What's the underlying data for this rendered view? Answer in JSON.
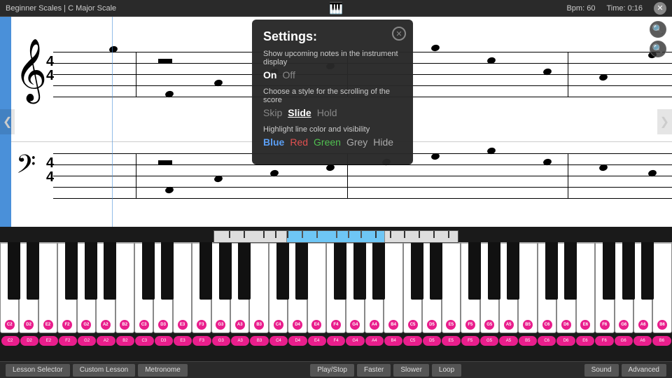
{
  "topBar": {
    "breadcrumb": "Beginner Scales  |  C Major Scale",
    "bpm_label": "Bpm: 60",
    "time_label": "Time: 0:16",
    "close_label": "✕"
  },
  "settings": {
    "title": "Settings:",
    "show_notes_label": "Show upcoming notes in the instrument display",
    "on_label": "On",
    "off_label": "Off",
    "scroll_label": "Choose a style for the scrolling of the score",
    "skip_label": "Skip",
    "slide_label": "Slide",
    "hold_label": "Hold",
    "highlight_label": "Highlight line color and visibility",
    "blue_label": "Blue",
    "red_label": "Red",
    "green_label": "Green",
    "grey_label": "Grey",
    "hide_label": "Hide",
    "close_label": "✕"
  },
  "navigation": {
    "left_arrow": "❮",
    "right_arrow": "❯"
  },
  "bottomBar": {
    "lesson_selector": "Lesson Selector",
    "custom_lesson": "Custom Lesson",
    "metronome": "Metronome",
    "play_stop": "Play/Stop",
    "faster": "Faster",
    "slower": "Slower",
    "loop": "Loop",
    "sound": "Sound",
    "advanced": "Advanced"
  },
  "keyLabels": [
    "C2",
    "D2",
    "E2",
    "F2",
    "G2",
    "A2",
    "B2",
    "C3",
    "D3",
    "E3",
    "F3",
    "G3",
    "A3",
    "B3",
    "C4",
    "D4",
    "E4",
    "F4",
    "G4",
    "A4",
    "B4",
    "C5",
    "D5",
    "E5",
    "F5",
    "G5",
    "A5",
    "B5",
    "C6",
    "D6",
    "E6",
    "F6",
    "G6",
    "A6",
    "B6"
  ],
  "colors": {
    "blue_bar": "#4a90d9",
    "pink": "#e91e8c",
    "highlight": "#6ec6f5"
  }
}
